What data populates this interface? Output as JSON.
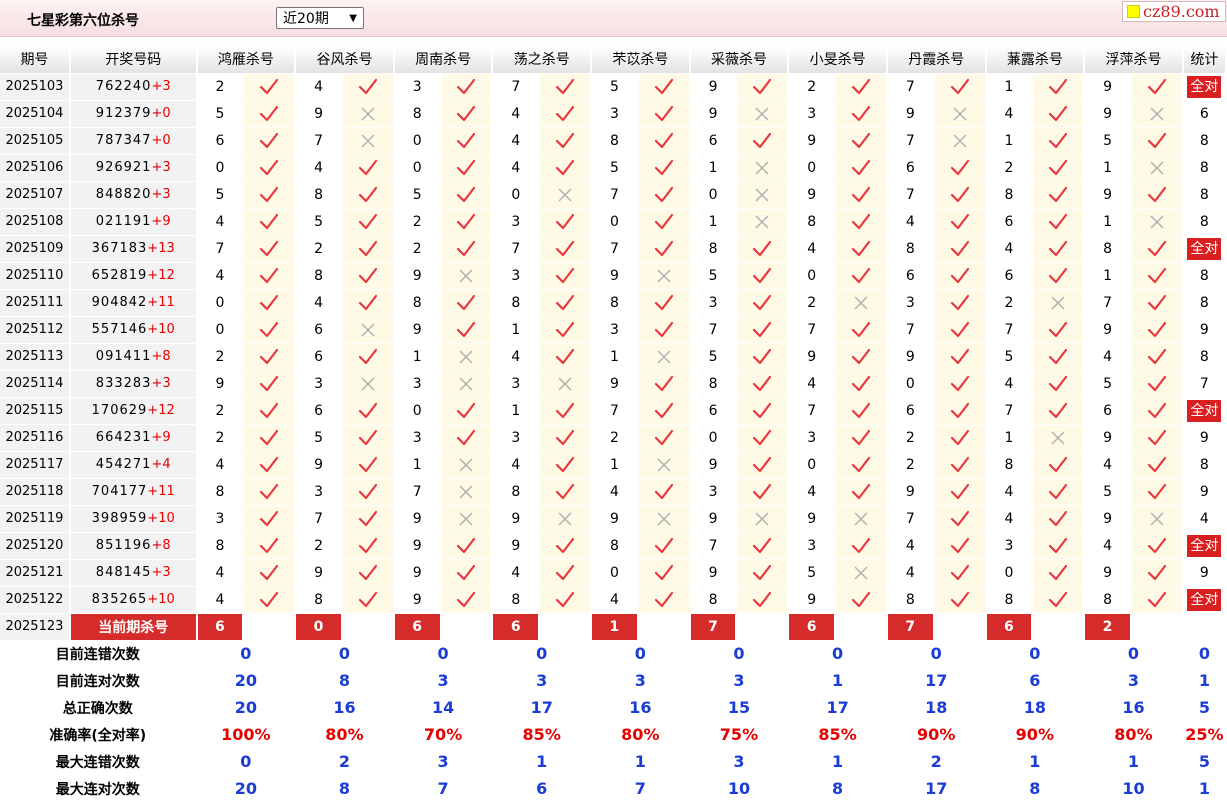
{
  "header": {
    "title": "七星彩第六位杀号",
    "period_select": "近20期",
    "logo_text": "cz89.com"
  },
  "columns": {
    "qihao": "期号",
    "number": "开奖号码",
    "stat": "统计"
  },
  "experts": [
    "鸿雁杀号",
    "谷风杀号",
    "周南杀号",
    "荡之杀号",
    "芣苡杀号",
    "采薇杀号",
    "小旻杀号",
    "丹霞杀号",
    "蒹露杀号",
    "浮萍杀号"
  ],
  "rows": [
    {
      "qh": "2025103",
      "nums": "762240",
      "sum": "+3",
      "kills": [
        "2",
        "4",
        "3",
        "7",
        "5",
        "9",
        "2",
        "7",
        "1",
        "9"
      ],
      "res": [
        1,
        1,
        1,
        1,
        1,
        1,
        1,
        1,
        1,
        1
      ],
      "stat": "全对"
    },
    {
      "qh": "2025104",
      "nums": "912379",
      "sum": "+0",
      "kills": [
        "5",
        "9",
        "8",
        "4",
        "3",
        "9",
        "3",
        "9",
        "4",
        "9"
      ],
      "res": [
        1,
        0,
        1,
        1,
        1,
        0,
        1,
        0,
        1,
        0
      ],
      "stat": "6"
    },
    {
      "qh": "2025105",
      "nums": "787347",
      "sum": "+0",
      "kills": [
        "6",
        "7",
        "0",
        "4",
        "8",
        "6",
        "9",
        "7",
        "1",
        "5"
      ],
      "res": [
        1,
        0,
        1,
        1,
        1,
        1,
        1,
        0,
        1,
        1
      ],
      "stat": "8"
    },
    {
      "qh": "2025106",
      "nums": "926921",
      "sum": "+3",
      "kills": [
        "0",
        "4",
        "0",
        "4",
        "5",
        "1",
        "0",
        "6",
        "2",
        "1"
      ],
      "res": [
        1,
        1,
        1,
        1,
        1,
        0,
        1,
        1,
        1,
        0
      ],
      "stat": "8"
    },
    {
      "qh": "2025107",
      "nums": "848820",
      "sum": "+3",
      "kills": [
        "5",
        "8",
        "5",
        "0",
        "7",
        "0",
        "9",
        "7",
        "8",
        "9"
      ],
      "res": [
        1,
        1,
        1,
        0,
        1,
        0,
        1,
        1,
        1,
        1
      ],
      "stat": "8"
    },
    {
      "qh": "2025108",
      "nums": "021191",
      "sum": "+9",
      "kills": [
        "4",
        "5",
        "2",
        "3",
        "0",
        "1",
        "8",
        "4",
        "6",
        "1"
      ],
      "res": [
        1,
        1,
        1,
        1,
        1,
        0,
        1,
        1,
        1,
        0
      ],
      "stat": "8"
    },
    {
      "qh": "2025109",
      "nums": "367183",
      "sum": "+13",
      "kills": [
        "7",
        "2",
        "2",
        "7",
        "7",
        "8",
        "4",
        "8",
        "4",
        "8"
      ],
      "res": [
        1,
        1,
        1,
        1,
        1,
        1,
        1,
        1,
        1,
        1
      ],
      "stat": "全对"
    },
    {
      "qh": "2025110",
      "nums": "652819",
      "sum": "+12",
      "kills": [
        "4",
        "8",
        "9",
        "3",
        "9",
        "5",
        "0",
        "6",
        "6",
        "1"
      ],
      "res": [
        1,
        1,
        0,
        1,
        0,
        1,
        1,
        1,
        1,
        1
      ],
      "stat": "8"
    },
    {
      "qh": "2025111",
      "nums": "904842",
      "sum": "+11",
      "kills": [
        "0",
        "4",
        "8",
        "8",
        "8",
        "3",
        "2",
        "3",
        "2",
        "7"
      ],
      "res": [
        1,
        1,
        1,
        1,
        1,
        1,
        0,
        1,
        0,
        1
      ],
      "stat": "8"
    },
    {
      "qh": "2025112",
      "nums": "557146",
      "sum": "+10",
      "kills": [
        "0",
        "6",
        "9",
        "1",
        "3",
        "7",
        "7",
        "7",
        "7",
        "9"
      ],
      "res": [
        1,
        0,
        1,
        1,
        1,
        1,
        1,
        1,
        1,
        1
      ],
      "stat": "9"
    },
    {
      "qh": "2025113",
      "nums": "091411",
      "sum": "+8",
      "kills": [
        "2",
        "6",
        "1",
        "4",
        "1",
        "5",
        "9",
        "9",
        "5",
        "4"
      ],
      "res": [
        1,
        1,
        0,
        1,
        0,
        1,
        1,
        1,
        1,
        1
      ],
      "stat": "8"
    },
    {
      "qh": "2025114",
      "nums": "833283",
      "sum": "+3",
      "kills": [
        "9",
        "3",
        "3",
        "3",
        "9",
        "8",
        "4",
        "0",
        "4",
        "5"
      ],
      "res": [
        1,
        0,
        0,
        0,
        1,
        1,
        1,
        1,
        1,
        1
      ],
      "stat": "7"
    },
    {
      "qh": "2025115",
      "nums": "170629",
      "sum": "+12",
      "kills": [
        "2",
        "6",
        "0",
        "1",
        "7",
        "6",
        "7",
        "6",
        "7",
        "6"
      ],
      "res": [
        1,
        1,
        1,
        1,
        1,
        1,
        1,
        1,
        1,
        1
      ],
      "stat": "全对"
    },
    {
      "qh": "2025116",
      "nums": "664231",
      "sum": "+9",
      "kills": [
        "2",
        "5",
        "3",
        "3",
        "2",
        "0",
        "3",
        "2",
        "1",
        "9"
      ],
      "res": [
        1,
        1,
        1,
        1,
        1,
        1,
        1,
        1,
        0,
        1
      ],
      "stat": "9"
    },
    {
      "qh": "2025117",
      "nums": "454271",
      "sum": "+4",
      "kills": [
        "4",
        "9",
        "1",
        "4",
        "1",
        "9",
        "0",
        "2",
        "8",
        "4"
      ],
      "res": [
        1,
        1,
        0,
        1,
        0,
        1,
        1,
        1,
        1,
        1
      ],
      "stat": "8"
    },
    {
      "qh": "2025118",
      "nums": "704177",
      "sum": "+11",
      "kills": [
        "8",
        "3",
        "7",
        "8",
        "4",
        "3",
        "4",
        "9",
        "4",
        "5"
      ],
      "res": [
        1,
        1,
        0,
        1,
        1,
        1,
        1,
        1,
        1,
        1
      ],
      "stat": "9"
    },
    {
      "qh": "2025119",
      "nums": "398959",
      "sum": "+10",
      "kills": [
        "3",
        "7",
        "9",
        "9",
        "9",
        "9",
        "9",
        "7",
        "4",
        "9"
      ],
      "res": [
        1,
        1,
        0,
        0,
        0,
        0,
        0,
        1,
        1,
        0
      ],
      "stat": "4"
    },
    {
      "qh": "2025120",
      "nums": "851196",
      "sum": "+8",
      "kills": [
        "8",
        "2",
        "9",
        "9",
        "8",
        "7",
        "3",
        "4",
        "3",
        "4"
      ],
      "res": [
        1,
        1,
        1,
        1,
        1,
        1,
        1,
        1,
        1,
        1
      ],
      "stat": "全对"
    },
    {
      "qh": "2025121",
      "nums": "848145",
      "sum": "+3",
      "kills": [
        "4",
        "9",
        "9",
        "4",
        "0",
        "9",
        "5",
        "4",
        "0",
        "9"
      ],
      "res": [
        1,
        1,
        1,
        1,
        1,
        1,
        0,
        1,
        1,
        1
      ],
      "stat": "9"
    },
    {
      "qh": "2025122",
      "nums": "835265",
      "sum": "+10",
      "kills": [
        "4",
        "8",
        "9",
        "8",
        "4",
        "8",
        "9",
        "8",
        "8",
        "8"
      ],
      "res": [
        1,
        1,
        1,
        1,
        1,
        1,
        1,
        1,
        1,
        1
      ],
      "stat": "全对"
    }
  ],
  "current": {
    "qh": "2025123",
    "label": "当前期杀号",
    "kills": [
      "6",
      "0",
      "6",
      "6",
      "1",
      "7",
      "6",
      "7",
      "6",
      "2"
    ]
  },
  "summary": [
    {
      "label": "目前连错次数",
      "vals": [
        "0",
        "0",
        "0",
        "0",
        "0",
        "0",
        "0",
        "0",
        "0",
        "0"
      ],
      "stat": "0",
      "color": "blue"
    },
    {
      "label": "目前连对次数",
      "vals": [
        "20",
        "8",
        "3",
        "3",
        "3",
        "3",
        "1",
        "17",
        "6",
        "3"
      ],
      "stat": "1",
      "color": "blue"
    },
    {
      "label": "总正确次数",
      "vals": [
        "20",
        "16",
        "14",
        "17",
        "16",
        "15",
        "17",
        "18",
        "18",
        "16"
      ],
      "stat": "5",
      "color": "blue"
    },
    {
      "label": "准确率(全对率)",
      "vals": [
        "100%",
        "80%",
        "70%",
        "85%",
        "80%",
        "75%",
        "85%",
        "90%",
        "90%",
        "80%"
      ],
      "stat": "25%",
      "color": "red"
    },
    {
      "label": "最大连错次数",
      "vals": [
        "0",
        "2",
        "3",
        "1",
        "1",
        "3",
        "1",
        "2",
        "1",
        "1"
      ],
      "stat": "5",
      "color": "blue"
    },
    {
      "label": "最大连对次数",
      "vals": [
        "20",
        "8",
        "7",
        "6",
        "7",
        "10",
        "8",
        "17",
        "8",
        "10"
      ],
      "stat": "1",
      "color": "blue"
    }
  ]
}
